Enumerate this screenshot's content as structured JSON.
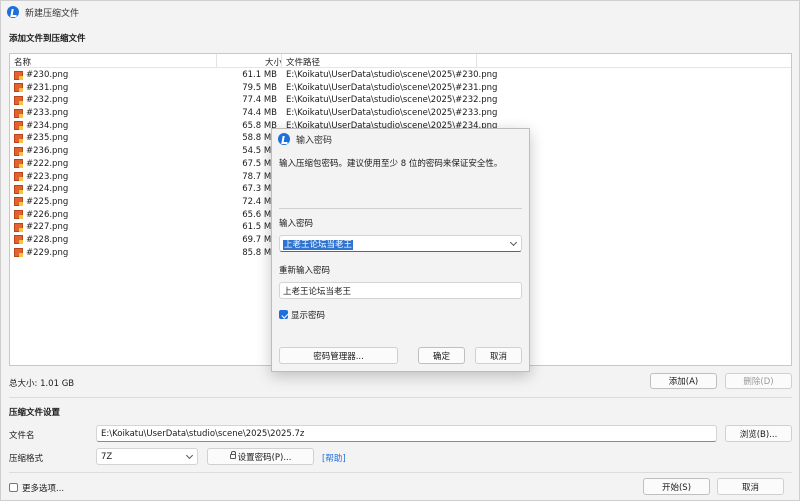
{
  "window": {
    "title": "新建压缩文件"
  },
  "add_section": {
    "title": "添加文件到压缩文件",
    "columns": {
      "name": "名称",
      "size": "大小",
      "path": "文件路径"
    },
    "files": [
      {
        "name": "#230.png",
        "size": "61.1 MB",
        "path": "E:\\Koikatu\\UserData\\studio\\scene\\2025\\#230.png"
      },
      {
        "name": "#231.png",
        "size": "79.5 MB",
        "path": "E:\\Koikatu\\UserData\\studio\\scene\\2025\\#231.png"
      },
      {
        "name": "#232.png",
        "size": "77.4 MB",
        "path": "E:\\Koikatu\\UserData\\studio\\scene\\2025\\#232.png"
      },
      {
        "name": "#233.png",
        "size": "74.4 MB",
        "path": "E:\\Koikatu\\UserData\\studio\\scene\\2025\\#233.png"
      },
      {
        "name": "#234.png",
        "size": "65.8 MB",
        "path": "E:\\Koikatu\\UserData\\studio\\scene\\2025\\#234.png"
      },
      {
        "name": "#235.png",
        "size": "58.8 MB",
        "path": ""
      },
      {
        "name": "#236.png",
        "size": "54.5 MB",
        "path": ""
      },
      {
        "name": "#222.png",
        "size": "67.5 MB",
        "path": ""
      },
      {
        "name": "#223.png",
        "size": "78.7 MB",
        "path": ""
      },
      {
        "name": "#224.png",
        "size": "67.3 MB",
        "path": ""
      },
      {
        "name": "#225.png",
        "size": "72.4 MB",
        "path": ""
      },
      {
        "name": "#226.png",
        "size": "65.6 MB",
        "path": ""
      },
      {
        "name": "#227.png",
        "size": "61.5 MB",
        "path": ""
      },
      {
        "name": "#228.png",
        "size": "69.7 MB",
        "path": ""
      },
      {
        "name": "#229.png",
        "size": "85.8 MB",
        "path": ""
      }
    ],
    "total_size": "总大小: 1.01 GB",
    "add_button": "添加(A)",
    "delete_button": "删除(D)"
  },
  "settings": {
    "title": "压缩文件设置",
    "filename_label": "文件名",
    "filename_value": "E:\\Koikatu\\UserData\\studio\\scene\\2025\\2025.7z",
    "browse_button": "浏览(B)...",
    "format_label": "压缩格式",
    "format_value": "7Z",
    "set_password_button": "设置密码(P)...",
    "help_link": "[帮助]"
  },
  "footer": {
    "more_options": "更多选项...",
    "start_button": "开始(S)",
    "cancel_button": "取消"
  },
  "password_dialog": {
    "title": "输入密码",
    "description": "输入压缩包密码。建议使用至少 8 位的密码来保证安全性。",
    "password_label": "输入密码",
    "password_value": "上老王论坛当老王",
    "confirm_label": "重新输入密码",
    "confirm_value": "上老王论坛当老王",
    "show_password": "显示密码",
    "show_password_checked": true,
    "manager_button": "密码管理器...",
    "ok_button": "确定",
    "cancel_button": "取消"
  },
  "colors": {
    "accent": "#1e6fd9",
    "selection": "#2f74d0"
  }
}
